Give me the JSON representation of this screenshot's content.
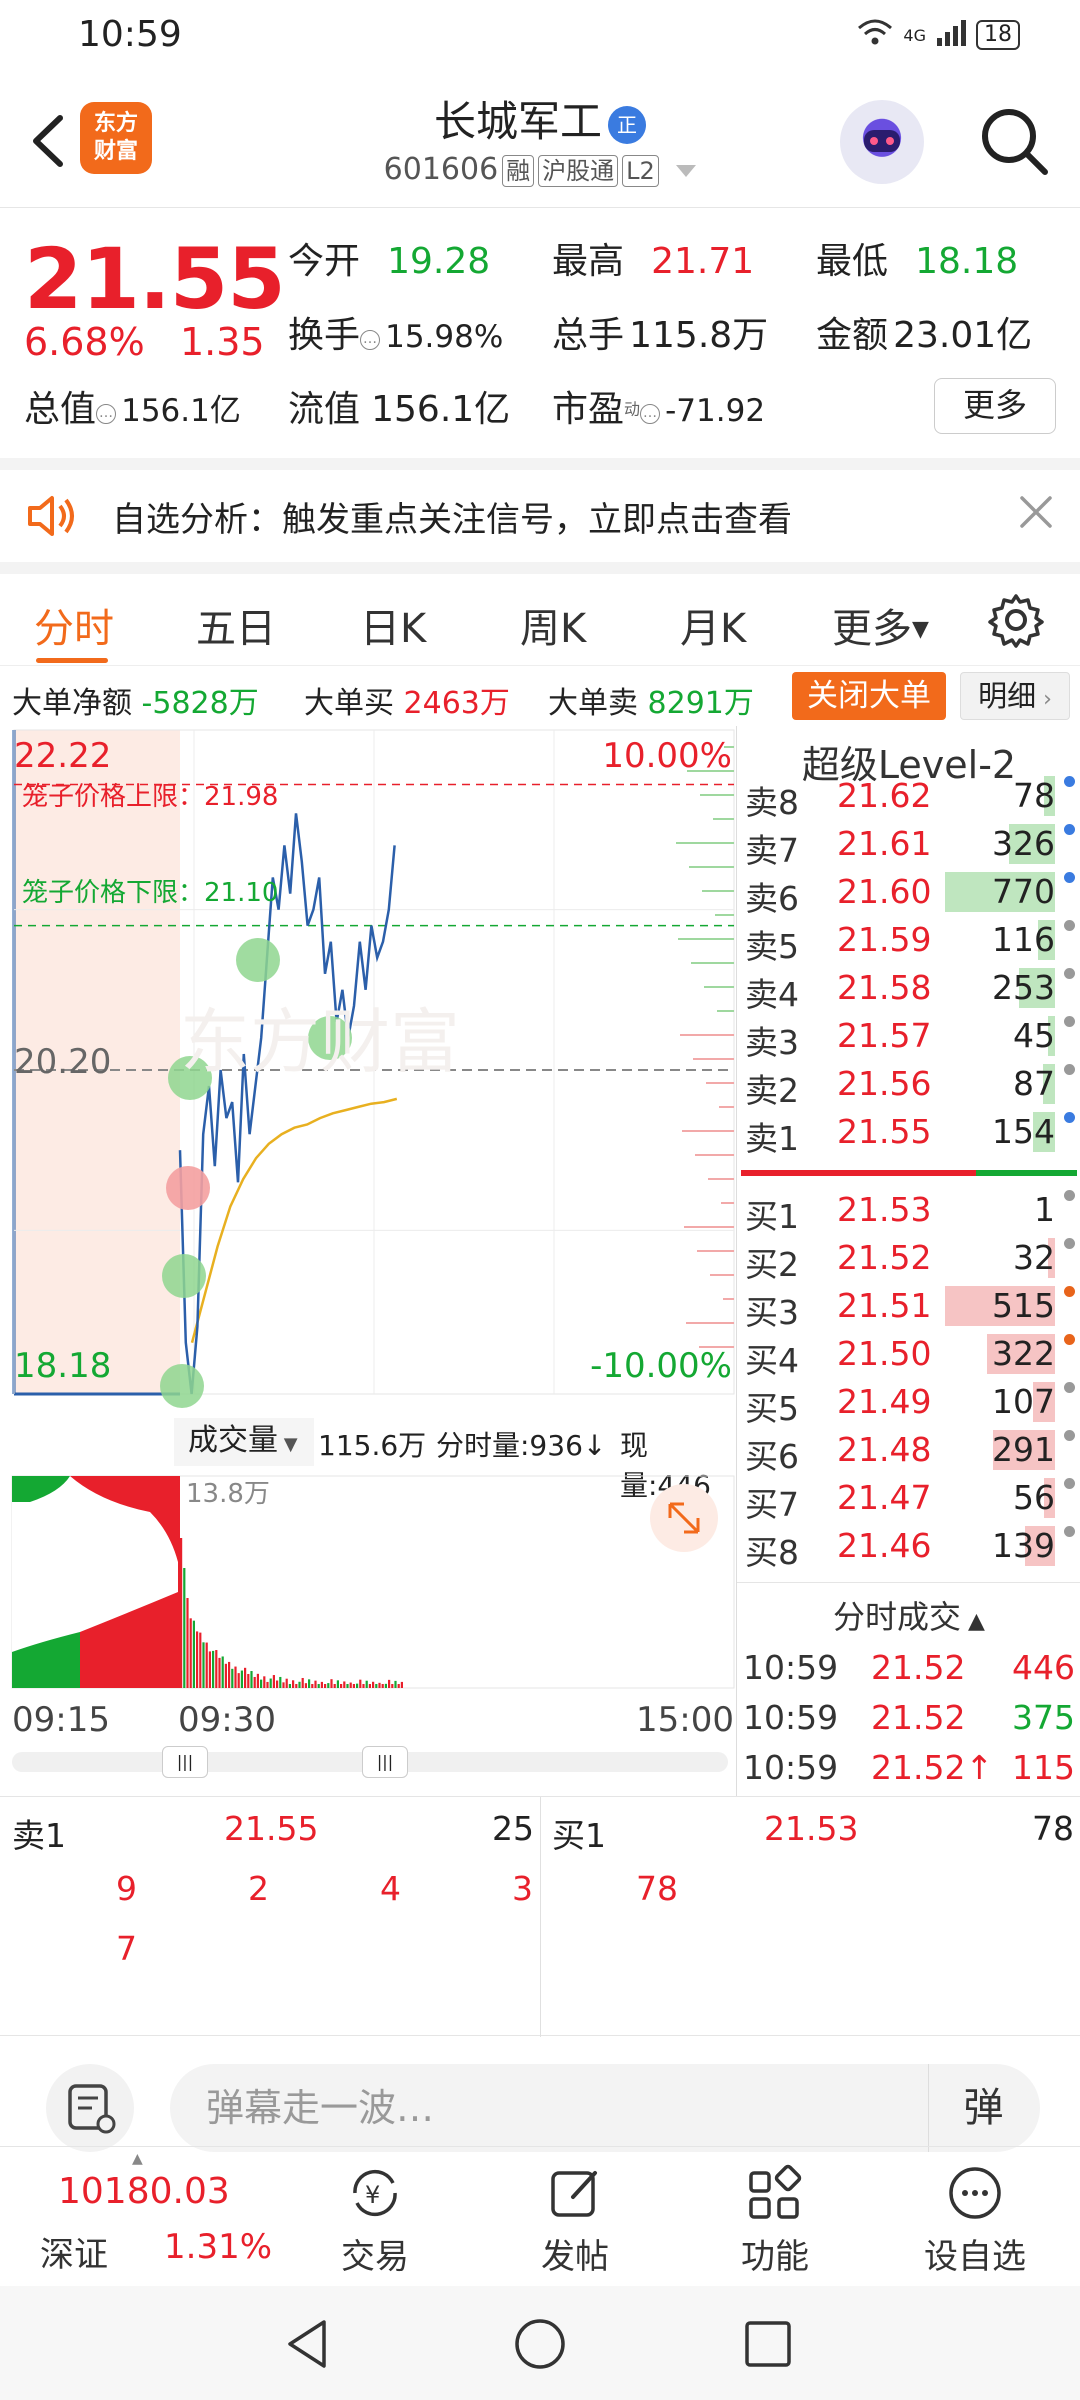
{
  "status_bar": {
    "time": "10:59",
    "network": "4G",
    "battery": "18"
  },
  "header": {
    "logo_line1": "东方",
    "logo_line2": "财富",
    "stock_name": "长城军工",
    "name_badge": "正",
    "stock_code": "601606",
    "tags": [
      "融",
      "沪股通",
      "L2"
    ]
  },
  "quote": {
    "price": "21.55",
    "change_pct": "6.68%",
    "change": "1.35",
    "fields": [
      {
        "label": "今开",
        "value": "19.28",
        "color": "green"
      },
      {
        "label": "最高",
        "value": "21.71",
        "color": "red"
      },
      {
        "label": "最低",
        "value": "18.18",
        "color": "green"
      },
      {
        "label": "换手",
        "value": "15.98%",
        "color": "black"
      },
      {
        "label": "总手",
        "value": "115.8万",
        "color": "black"
      },
      {
        "label": "金额",
        "value": "23.01亿",
        "color": "black"
      },
      {
        "label": "总值",
        "value": "156.1亿",
        "color": "black"
      },
      {
        "label": "流值",
        "value": "156.1亿",
        "color": "black"
      },
      {
        "label": "市盈",
        "label_sup": "动",
        "value": "-71.92",
        "color": "black"
      }
    ],
    "more_label": "更多"
  },
  "banner": {
    "text": "自选分析：触发重点关注信号，立即点击查看"
  },
  "tabs": [
    "分时",
    "五日",
    "日K",
    "周K",
    "月K",
    "更多"
  ],
  "big_order": {
    "net_label": "大单净额",
    "net_value": "-5828万",
    "buy_label": "大单买",
    "buy_value": "2463万",
    "sell_label": "大单卖",
    "sell_value": "8291万",
    "close_label": "关闭大单",
    "detail_label": "明细"
  },
  "chart_data": {
    "type": "line",
    "price_top": "22.22",
    "price_mid": "20.20",
    "price_bottom": "18.18",
    "pct_top": "10.00%",
    "pct_bottom": "-10.00%",
    "cage_upper_label": "笼子价格上限：21.98",
    "cage_lower_label": "笼子价格下限：21.10",
    "cage_upper": 21.98,
    "cage_lower": 21.1,
    "ylim": [
      18.18,
      22.22
    ],
    "x_labels": [
      "09:15",
      "09:30",
      "15:00"
    ],
    "price_series": [
      19.7,
      18.5,
      18.18,
      18.6,
      19.8,
      20.1,
      19.6,
      20.2,
      19.9,
      20.0,
      19.5,
      20.3,
      19.8,
      20.1,
      20.4,
      20.9,
      21.4,
      21.2,
      21.6,
      21.3,
      21.8,
      21.5,
      21.1,
      21.2,
      21.4,
      20.8,
      21.0,
      20.5,
      20.7,
      20.4,
      20.6,
      21.0,
      20.7,
      21.1,
      20.9,
      21.0,
      21.2,
      21.6
    ],
    "avg_series": [
      18.5,
      18.8,
      19.1,
      19.35,
      19.52,
      19.65,
      19.74,
      19.8,
      19.84,
      19.86,
      19.9,
      19.93,
      19.95,
      19.97,
      19.99,
      20.0,
      20.02
    ]
  },
  "volume": {
    "selector_label": "成交量",
    "total": "115.6万",
    "tick_vol_label": "分时量:936↓",
    "current_label": "现量:446",
    "max_label": "13.8万"
  },
  "level2": {
    "title": "超级Level-2",
    "asks": [
      {
        "label": "卖8",
        "price": "21.62",
        "vol": "78",
        "bar": 0.1,
        "dot": "#3a7be0"
      },
      {
        "label": "卖7",
        "price": "21.61",
        "vol": "326",
        "bar": 0.42,
        "dot": "#3a7be0"
      },
      {
        "label": "卖6",
        "price": "21.60",
        "vol": "770",
        "bar": 1.0,
        "dot": "#3a7be0"
      },
      {
        "label": "卖5",
        "price": "21.59",
        "vol": "116",
        "bar": 0.15,
        "dot": "#999"
      },
      {
        "label": "卖4",
        "price": "21.58",
        "vol": "253",
        "bar": 0.33,
        "dot": "#999"
      },
      {
        "label": "卖3",
        "price": "21.57",
        "vol": "45",
        "bar": 0.06,
        "dot": "#999"
      },
      {
        "label": "卖2",
        "price": "21.56",
        "vol": "87",
        "bar": 0.11,
        "dot": "#999"
      },
      {
        "label": "卖1",
        "price": "21.55",
        "vol": "154",
        "bar": 0.2,
        "dot": "#3a7be0"
      }
    ],
    "bids": [
      {
        "label": "买1",
        "price": "21.53",
        "vol": "1",
        "bar": 0.0,
        "dot": "#999"
      },
      {
        "label": "买2",
        "price": "21.52",
        "vol": "32",
        "bar": 0.06,
        "dot": "#999"
      },
      {
        "label": "买3",
        "price": "21.51",
        "vol": "515",
        "bar": 1.0,
        "dot": "#e8641b"
      },
      {
        "label": "买4",
        "price": "21.50",
        "vol": "322",
        "bar": 0.62,
        "dot": "#e8641b"
      },
      {
        "label": "买5",
        "price": "21.49",
        "vol": "107",
        "bar": 0.2,
        "dot": "#999"
      },
      {
        "label": "买6",
        "price": "21.48",
        "vol": "291",
        "bar": 0.56,
        "dot": "#999"
      },
      {
        "label": "买7",
        "price": "21.47",
        "vol": "56",
        "bar": 0.1,
        "dot": "#999"
      },
      {
        "label": "买8",
        "price": "21.46",
        "vol": "139",
        "bar": 0.27,
        "dot": "#999"
      }
    ],
    "trades_title": "分时成交",
    "trades": [
      {
        "time": "10:59",
        "price": "21.52",
        "arrow": "",
        "vol": "446",
        "vcolor": "#e8202b"
      },
      {
        "time": "10:59",
        "price": "21.52",
        "arrow": "",
        "vol": "375",
        "vcolor": "#14a833"
      },
      {
        "time": "10:59",
        "price": "21.52",
        "arrow": "↑",
        "vol": "115",
        "vcolor": "#e8202b"
      }
    ]
  },
  "bottom_quote": {
    "sell_label": "卖1",
    "sell_price": "21.55",
    "sell_vol": "25",
    "sell_queue": [
      "9",
      "2",
      "4",
      "3",
      "7"
    ],
    "buy_label": "买1",
    "buy_price": "21.53",
    "buy_vol": "78",
    "buy_queue": [
      "78"
    ]
  },
  "comment": {
    "placeholder": "弹幕走一波…",
    "danmu_label": "弹"
  },
  "index": {
    "value": "10180.03",
    "name": "深证",
    "pct": "1.31%"
  },
  "nav": [
    {
      "label": "交易",
      "icon": "trade-icon"
    },
    {
      "label": "发帖",
      "icon": "post-icon"
    },
    {
      "label": "功能",
      "icon": "function-icon"
    },
    {
      "label": "设自选",
      "icon": "add-watchlist-icon"
    }
  ]
}
